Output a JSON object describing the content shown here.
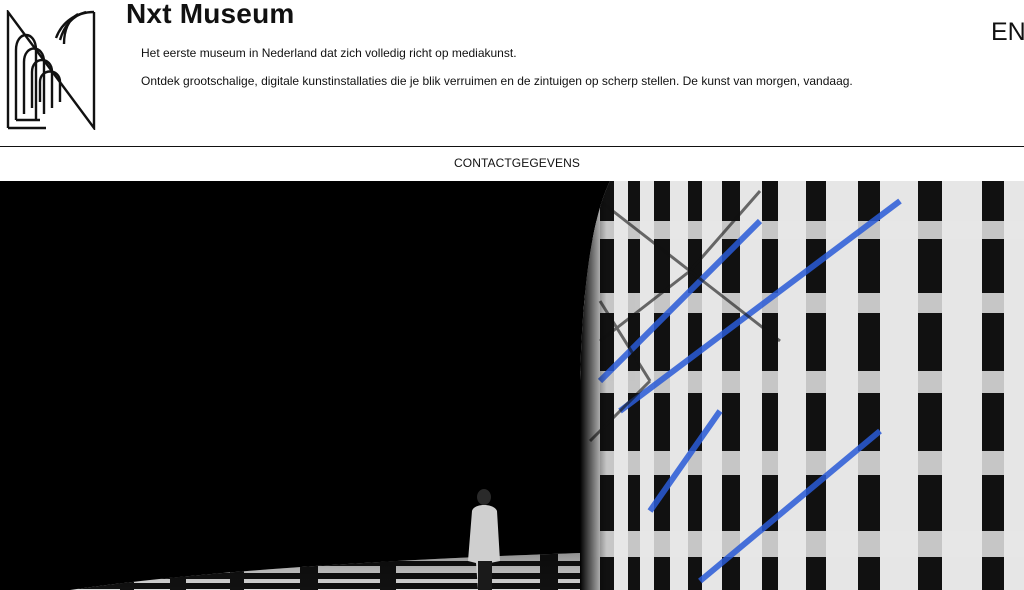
{
  "site": {
    "title": "Nxt Museum",
    "language_toggle": "EN"
  },
  "intro": {
    "line1": "Het eerste museum in Nederland dat zich volledig richt op mediakunst.",
    "line2": "Ontdek grootschalige, digitale kunstinstallaties die je blik verruimen en de zintuigen op scherp stellen. De kunst van morgen, vandaag."
  },
  "nav": {
    "contact": "CONTACTGEGEVENS"
  },
  "colors": {
    "background": "#ffffff",
    "text": "#111111",
    "hero_bg": "#000000",
    "accent_blue": "#2a5bd7"
  }
}
